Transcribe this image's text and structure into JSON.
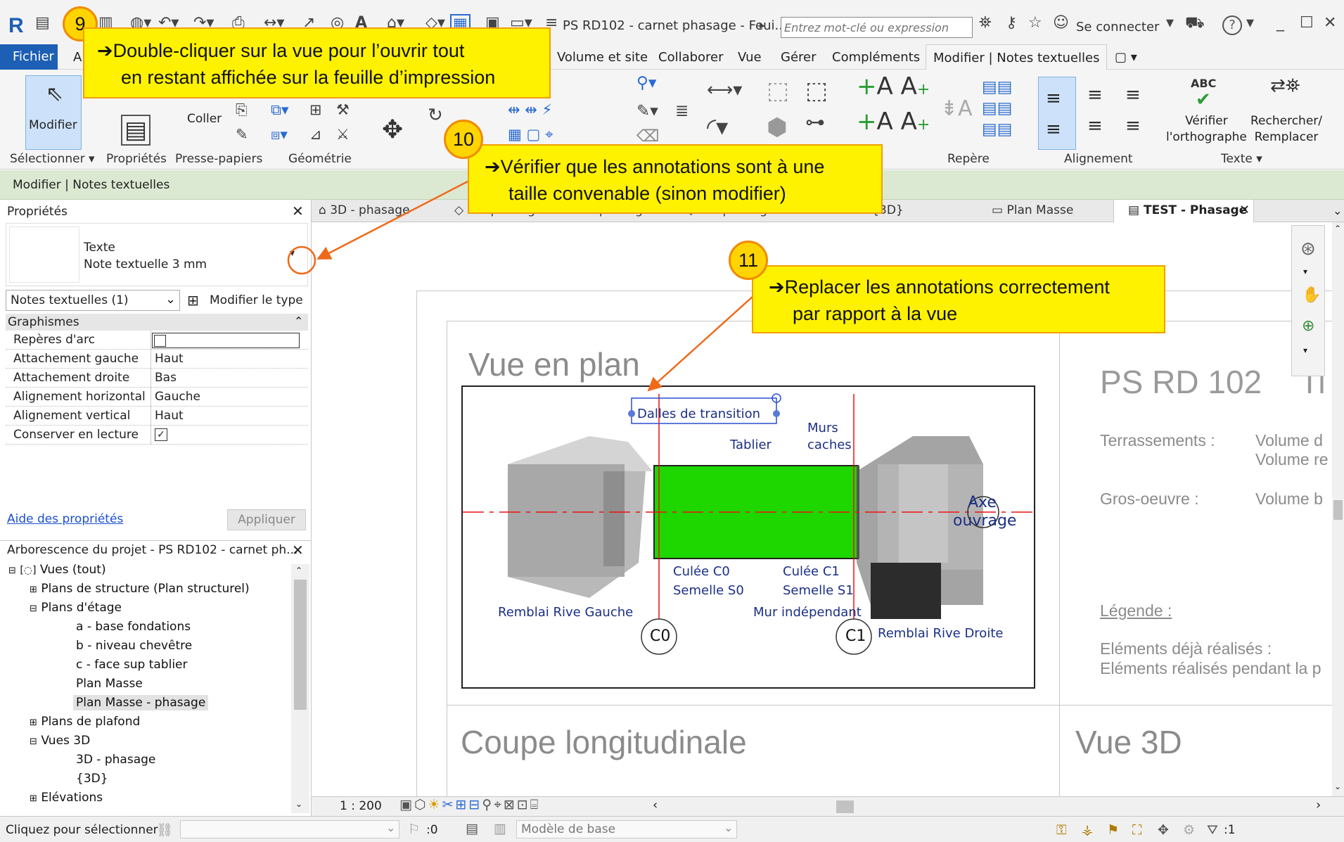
{
  "titlebar": {
    "logo": "R",
    "doc_title": "PS RD102 - carnet phasage - Feui...",
    "search_placeholder": "Entrez mot-clé ou expression",
    "signin": "Se connecter",
    "help": "?",
    "icons": [
      "binoculars-icon",
      "key-icon",
      "star-icon",
      "user-icon",
      "cart-icon",
      "help-icon",
      "minimize-icon",
      "maximize-icon",
      "close-icon"
    ]
  },
  "menu": {
    "fichier": "Fichier",
    "a": "A",
    "items": [
      "Volume et site",
      "Collaborer",
      "Vue",
      "Gérer",
      "Compléments",
      "Modifier | Notes textuelles"
    ],
    "extra": "▢ ▾"
  },
  "ribbon": {
    "modifier": "Modifier",
    "coller": "Coller",
    "verifier": "Vérifier\nl'orthographe",
    "rechercher": "Rechercher/\nRemplacer",
    "abc": "ABC",
    "groups": {
      "selectionner": "Sélectionner ▾",
      "proprietes": "Propriétés",
      "presse": "Presse-papiers",
      "geometrie": "Géométrie",
      "repere": "Repère",
      "alignement": "Alignement",
      "texte": "Texte ▾"
    }
  },
  "context_bar": "Modifier | Notes textuelles",
  "properties": {
    "title": "Propriétés",
    "type_name": "Texte",
    "type_sub": "Note textuelle 3 mm",
    "selector": "Notes textuelles (1)",
    "edit_type": "Modifier le type",
    "section": "Graphismes",
    "rows": [
      {
        "k": "Repères d'arc",
        "v": ""
      },
      {
        "k": "Attachement gauche",
        "v": "Haut"
      },
      {
        "k": "Attachement droite",
        "v": "Bas"
      },
      {
        "k": "Alignement horizontal",
        "v": "Gauche"
      },
      {
        "k": "Alignement vertical",
        "v": "Haut"
      },
      {
        "k": "Conserver en lecture",
        "v": ""
      }
    ],
    "help_link": "Aide des propriétés",
    "apply": "Appliquer"
  },
  "project_browser": {
    "title": "Arborescence du projet - PS RD102 - carnet ph...",
    "items": [
      "Vues (tout)",
      "Plans de structure (Plan structurel)",
      "Plans d'étage",
      "a - base fondations",
      "b - niveau chevêtre",
      "c - face sup tablier",
      "Plan Masse",
      "Plan Masse - phasage",
      "Plans de plafond",
      "Vues 3D",
      "3D - phasage",
      "{3D}",
      "Elévations"
    ]
  },
  "tabs": [
    "3D - phasage",
    "Coupe longitudinale - phasage",
    "Coupe longitudinale",
    "{3D}",
    "Plan Masse",
    "TEST - Phasage"
  ],
  "sheet": {
    "vue_en_plan": "Vue en plan",
    "ps": "PS RD 102",
    "ps_cut": "Ti",
    "terrassements": "Terrassements :",
    "volume_d": "Volume d",
    "volume_r": "Volume re",
    "gros_oeuvre": "Gros-oeuvre :",
    "volume_b": "Volume b",
    "legende": "Légende :",
    "elements1": "Eléments déjà réalisés :",
    "elements2": "Eléments réalisés pendant la p",
    "coupe": "Coupe longitudinale",
    "vue3d": "Vue 3D"
  },
  "plan": {
    "dalles": "Dalles de transition",
    "tablier": "Tablier",
    "murs1": "Murs",
    "murs2": "caches",
    "axe1": "Axe",
    "axe2": "ouvrage",
    "culee_c0": "Culée C0",
    "semelle_s0": "Semelle S0",
    "culee_c1": "Culée C1",
    "semelle_s1": "Semelle S1",
    "remblai_g": "Remblai Rive Gauche",
    "mur_ind": "Mur indépendant",
    "remblai_d": "Remblai Rive Droite",
    "c0": "C0",
    "c1": "C1",
    "deck_color": "#1ed600"
  },
  "callouts": {
    "n9": "9",
    "t9a": "➔Double-cliquer sur la vue pour l’ouvrir tout",
    "t9b": "en restant affichée sur la feuille d’impression",
    "n10": "10",
    "t10a": "➔Vérifier que les annotations sont à une",
    "t10b": "taille convenable (sinon modifier)",
    "n11": "11",
    "t11a": "➔Replacer les annotations correctement",
    "t11b": "par rapport à la vue",
    "arrow_color": "#ee6a1a"
  },
  "viewbar": {
    "scale": "1 : 200"
  },
  "status": {
    "hint": "Cliquez pour sélectionner",
    "count": ":0",
    "model": "Modèle de base",
    "filter": ":1"
  }
}
